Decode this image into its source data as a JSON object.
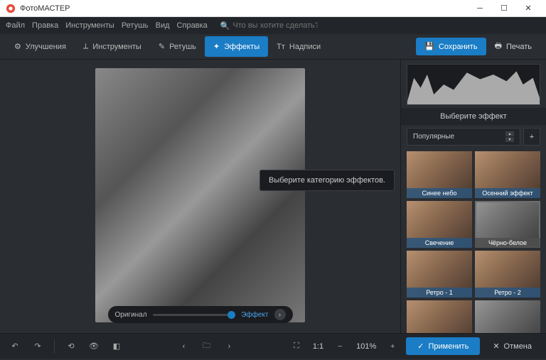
{
  "app": {
    "title": "ФотоМАСТЕР"
  },
  "menu": {
    "file": "Файл",
    "edit": "Правка",
    "tools": "Инструменты",
    "retouch": "Ретушь",
    "view": "Вид",
    "help": "Справка",
    "search_placeholder": "Что вы хотите сделать?"
  },
  "tabs": {
    "enhance": "Улучшения",
    "tools": "Инструменты",
    "retouch": "Ретушь",
    "effects": "Эффекты",
    "text": "Надписи"
  },
  "actions": {
    "save": "Сохранить",
    "print": "Печать",
    "apply": "Применить",
    "cancel": "Отмена"
  },
  "tooltip": "Выберите категорию эффектов.",
  "slider": {
    "original": "Оригинал",
    "effect": "Эффект"
  },
  "panel": {
    "title": "Выберите эффект",
    "category": "Популярные"
  },
  "effects": [
    {
      "label": "Синее небо",
      "bw": false
    },
    {
      "label": "Осенний эффект",
      "bw": false
    },
    {
      "label": "Свечение",
      "bw": false
    },
    {
      "label": "Чёрно-белое",
      "bw": true,
      "selected": true
    },
    {
      "label": "Ретро - 1",
      "bw": false
    },
    {
      "label": "Ретро - 2",
      "bw": false
    },
    {
      "label": "",
      "bw": false
    },
    {
      "label": "",
      "bw": true
    }
  ],
  "bottombar": {
    "fit": "1:1",
    "zoom": "101%"
  }
}
